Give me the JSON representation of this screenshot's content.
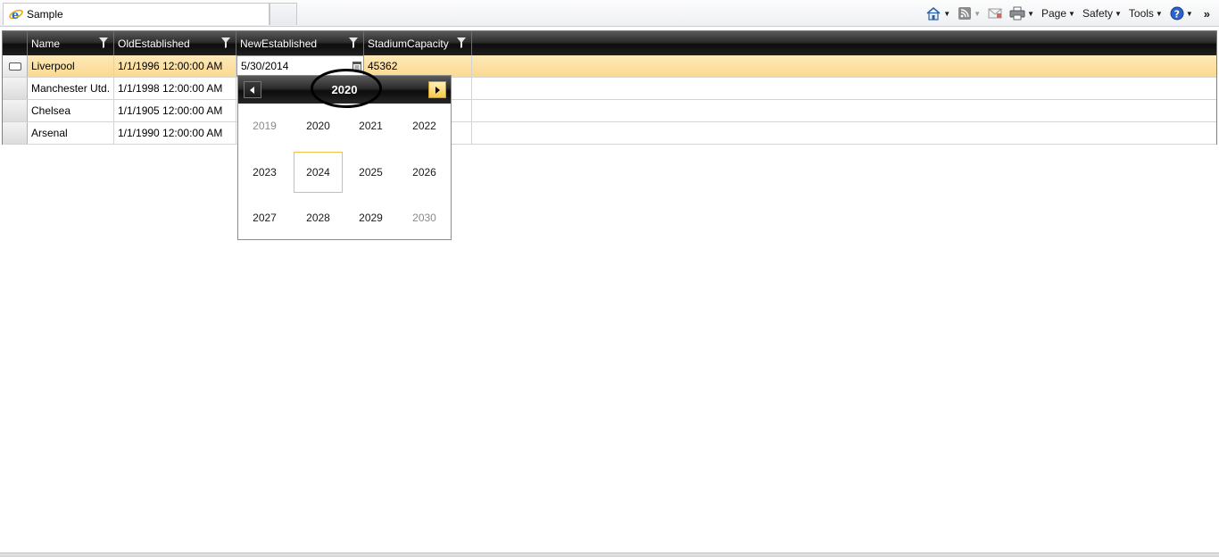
{
  "browser": {
    "tab_title": "Sample",
    "commands": {
      "page": "Page",
      "safety": "Safety",
      "tools": "Tools",
      "more": "»"
    }
  },
  "grid": {
    "columns": [
      "Name",
      "OldEstablished",
      "NewEstablished",
      "StadiumCapacity"
    ],
    "rows": [
      {
        "name": "Liverpool",
        "old": "1/1/1996 12:00:00 AM",
        "new": "5/30/2014",
        "capacity": "45362"
      },
      {
        "name": "Manchester Utd.",
        "old": "1/1/1998 12:00:00 AM"
      },
      {
        "name": "Chelsea",
        "old": "1/1/1905 12:00:00 AM"
      },
      {
        "name": "Arsenal",
        "old": "1/1/1990 12:00:00 AM"
      }
    ]
  },
  "calendar": {
    "title": "2020",
    "years": [
      "2019",
      "2020",
      "2021",
      "2022",
      "2023",
      "2024",
      "2025",
      "2026",
      "2027",
      "2028",
      "2029",
      "2030"
    ],
    "current_year": "2024",
    "muted_years": [
      "2019",
      "2030"
    ]
  },
  "colors": {
    "selected_row": "#fbd990",
    "header_dark": "#0d0d0d",
    "accent_gold": "#f7c84a"
  }
}
